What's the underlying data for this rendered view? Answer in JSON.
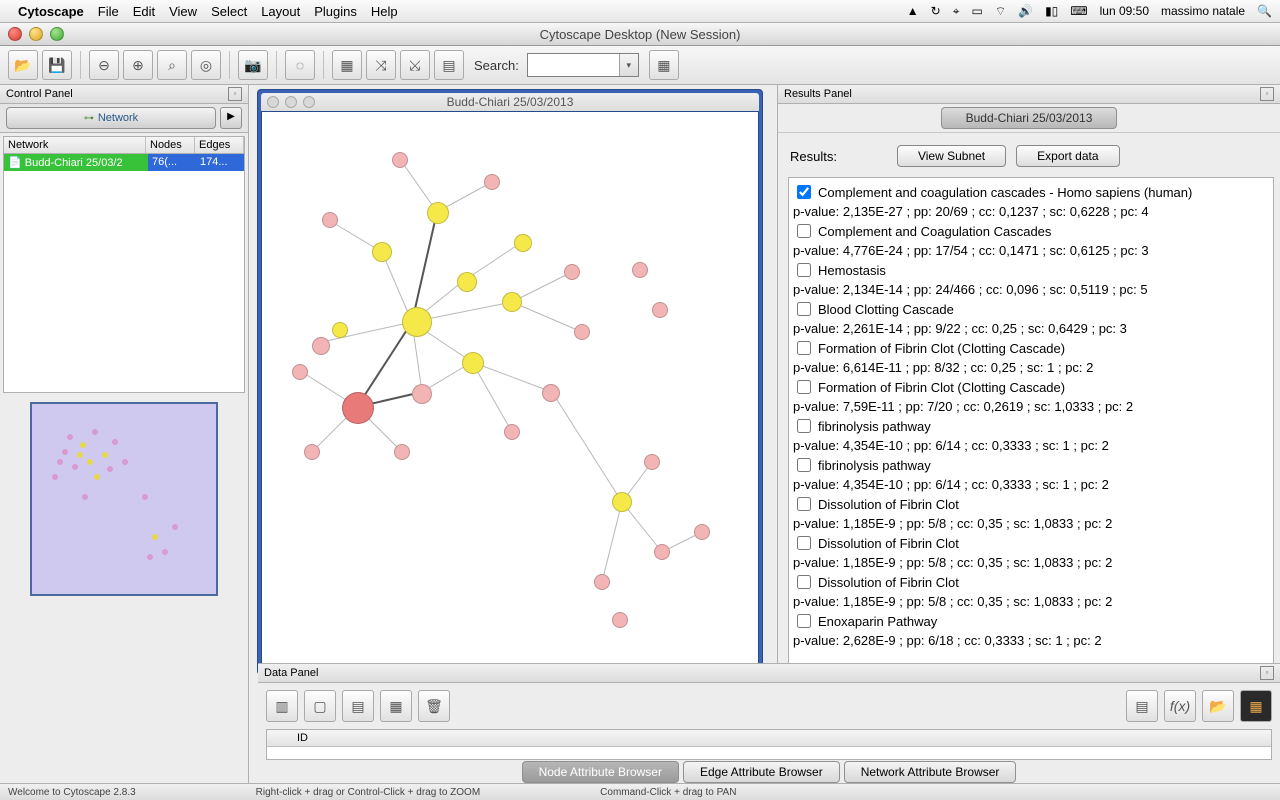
{
  "menubar": {
    "app": "Cytoscape",
    "items": [
      "File",
      "Edit",
      "View",
      "Select",
      "Layout",
      "Plugins",
      "Help"
    ],
    "time": "lun 09:50",
    "user": "massimo natale"
  },
  "window": {
    "title": "Cytoscape Desktop (New Session)"
  },
  "toolbar": {
    "search_label": "Search:"
  },
  "control_panel": {
    "title": "Control Panel",
    "tab": "Network",
    "columns": {
      "c0": "Network",
      "c1": "Nodes",
      "c2": "Edges"
    },
    "row": {
      "name": "Budd-Chiari 25/03/2",
      "nodes": "76(...",
      "edges": "174..."
    }
  },
  "network_window": {
    "title": "Budd-Chiari 25/03/2013"
  },
  "results_panel": {
    "title": "Results Panel",
    "tab": "Budd-Chiari 25/03/2013",
    "label": "Results:",
    "view_btn": "View Subnet",
    "export_btn": "Export data",
    "items": [
      {
        "checked": true,
        "name": "Complement and coagulation cascades - Homo sapiens (human)",
        "stats": "p-value: 2,135E-27 ; pp: 20/69 ; cc: 0,1237 ; sc: 0,6228 ; pc: 4"
      },
      {
        "checked": false,
        "name": "Complement and Coagulation Cascades",
        "stats": "p-value: 4,776E-24 ; pp: 17/54 ; cc: 0,1471 ; sc: 0,6125 ; pc: 3"
      },
      {
        "checked": false,
        "name": "Hemostasis",
        "stats": "p-value: 2,134E-14 ; pp: 24/466 ; cc: 0,096 ; sc: 0,5119 ; pc: 5"
      },
      {
        "checked": false,
        "name": "Blood Clotting Cascade",
        "stats": "p-value: 2,261E-14 ; pp: 9/22 ; cc: 0,25 ; sc: 0,6429 ; pc: 3"
      },
      {
        "checked": false,
        "name": "Formation of Fibrin Clot (Clotting Cascade)",
        "stats": "p-value: 6,614E-11 ; pp: 8/32 ; cc: 0,25 ; sc: 1 ; pc: 2"
      },
      {
        "checked": false,
        "name": "Formation of Fibrin Clot (Clotting Cascade)",
        "stats": "p-value: 7,59E-11 ; pp: 7/20 ; cc: 0,2619 ; sc: 1,0333 ; pc: 2"
      },
      {
        "checked": false,
        "name": "fibrinolysis pathway",
        "stats": "p-value: 4,354E-10 ; pp: 6/14 ; cc: 0,3333 ; sc: 1 ; pc: 2"
      },
      {
        "checked": false,
        "name": "fibrinolysis pathway",
        "stats": "p-value: 4,354E-10 ; pp: 6/14 ; cc: 0,3333 ; sc: 1 ; pc: 2"
      },
      {
        "checked": false,
        "name": "Dissolution of Fibrin Clot",
        "stats": "p-value: 1,185E-9 ; pp: 5/8 ; cc: 0,35 ; sc: 1,0833 ; pc: 2"
      },
      {
        "checked": false,
        "name": "Dissolution of Fibrin Clot",
        "stats": "p-value: 1,185E-9 ; pp: 5/8 ; cc: 0,35 ; sc: 1,0833 ; pc: 2"
      },
      {
        "checked": false,
        "name": "Dissolution of Fibrin Clot",
        "stats": "p-value: 1,185E-9 ; pp: 5/8 ; cc: 0,35 ; sc: 1,0833 ; pc: 2"
      },
      {
        "checked": false,
        "name": "Enoxaparin Pathway",
        "stats": "p-value: 2,628E-9 ; pp: 6/18 ; cc: 0,3333 ; sc: 1 ; pc: 2"
      }
    ]
  },
  "data_panel": {
    "title": "Data Panel",
    "id_col": "ID",
    "tabs": {
      "t0": "Node Attribute Browser",
      "t1": "Edge Attribute Browser",
      "t2": "Network Attribute Browser"
    }
  },
  "status": {
    "s0": "Welcome to Cytoscape 2.8.3",
    "s1": "Right-click + drag or Control-Click + drag to ZOOM",
    "s2": "Command-Click + drag to PAN"
  }
}
